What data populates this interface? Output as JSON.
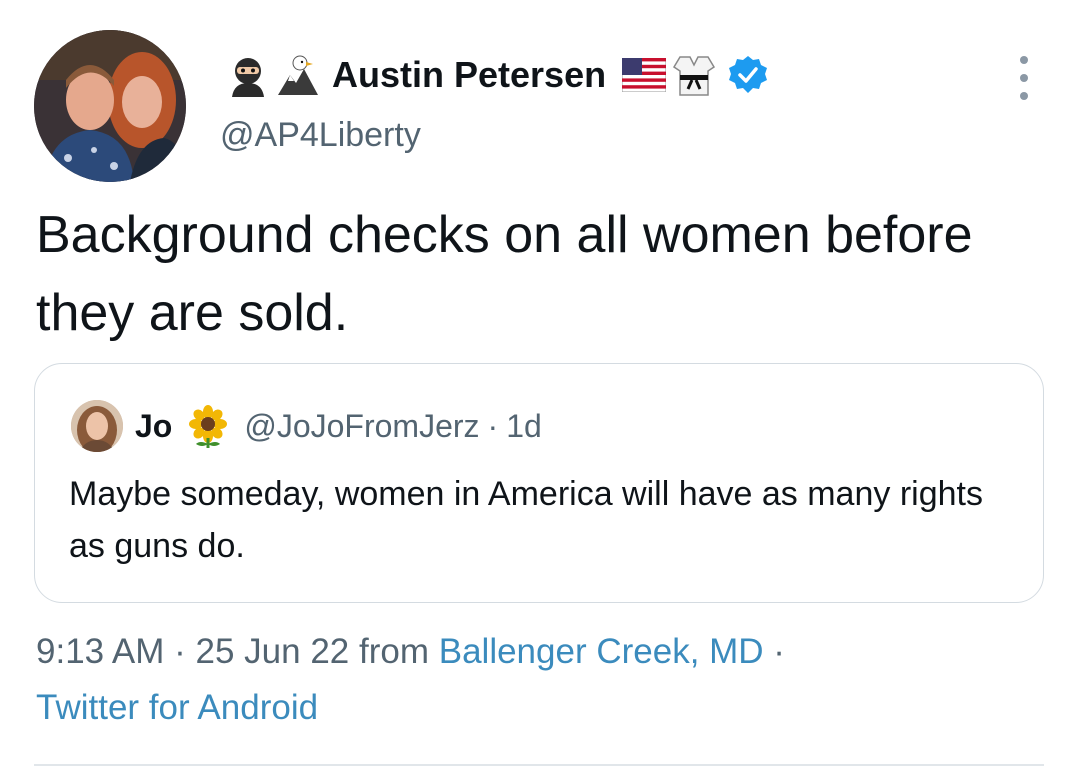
{
  "author": {
    "display_name": "Austin Petersen",
    "handle": "@AP4Liberty",
    "verified": true,
    "name_prefix_icons": [
      "ninja-icon",
      "eagle-icon"
    ],
    "name_suffix_icons": [
      "us-flag-icon",
      "karate-gi-icon"
    ]
  },
  "tweet": {
    "text": "Background checks on all women before they are sold."
  },
  "quoted_tweet": {
    "display_name": "Jo",
    "name_icon": "sunflower-icon",
    "handle": "@JoJoFromJerz",
    "separator": "·",
    "age": "1d",
    "text": "Maybe someday, women in America will have as many rights as guns do."
  },
  "meta": {
    "time": "9:13 AM",
    "sep1": " · ",
    "date": "25 Jun 22",
    "from_label": " from ",
    "location": "Ballenger Creek, MD",
    "sep2": " · ",
    "source": "Twitter for Android"
  },
  "colors": {
    "text": "#0f1419",
    "secondary": "#536471",
    "link": "#3b8bbd",
    "verified": "#1d9bf0",
    "border": "#d4dbe1"
  }
}
